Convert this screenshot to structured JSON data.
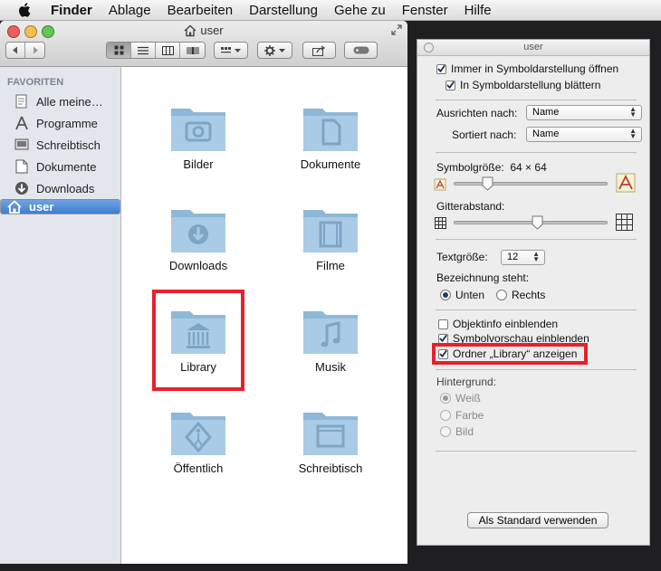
{
  "menubar": {
    "app_name": "Finder",
    "items": [
      "Ablage",
      "Bearbeiten",
      "Darstellung",
      "Gehe zu",
      "Fenster",
      "Hilfe"
    ]
  },
  "window": {
    "title": "user",
    "traffic_colors": [
      "#ed5f58",
      "#f5be4f",
      "#62c655"
    ]
  },
  "sidebar": {
    "header": "FAVORITEN",
    "items": [
      {
        "label": "Alle meine…",
        "icon": "all-files-icon"
      },
      {
        "label": "Programme",
        "icon": "applications-icon"
      },
      {
        "label": "Schreibtisch",
        "icon": "desktop-icon"
      },
      {
        "label": "Dokumente",
        "icon": "documents-icon"
      },
      {
        "label": "Downloads",
        "icon": "downloads-icon"
      },
      {
        "label": "user",
        "icon": "home-icon",
        "selected": true
      }
    ]
  },
  "folders": [
    {
      "label": "Bilder",
      "glyph": "camera"
    },
    {
      "label": "Dokumente",
      "glyph": "document"
    },
    {
      "label": "Downloads",
      "glyph": "download"
    },
    {
      "label": "Filme",
      "glyph": "film"
    },
    {
      "label": "Library",
      "glyph": "library",
      "highlighted": true
    },
    {
      "label": "Musik",
      "glyph": "music"
    },
    {
      "label": "Öffentlich",
      "glyph": "public"
    },
    {
      "label": "Schreibtisch",
      "glyph": "desktop"
    }
  ],
  "panel": {
    "title": "user",
    "always_icon_view": "Immer in Symboldarstellung öffnen",
    "browse_icon_view": "In Symboldarstellung blättern",
    "arrange_label": "Ausrichten nach:",
    "arrange_value": "Name",
    "sort_label": "Sortiert nach:",
    "sort_value": "Name",
    "icon_size_label": "Symbolgröße:",
    "icon_size_value": "64 × 64",
    "icon_size_level": 0.2,
    "grid_label": "Gitterabstand:",
    "grid_level": 0.55,
    "text_size_label": "Textgröße:",
    "text_size_value": "12",
    "label_position_label": "Bezeichnung steht:",
    "label_bottom": "Unten",
    "label_right": "Rechts",
    "show_item_info": "Objektinfo einblenden",
    "show_icon_preview": "Symbolvorschau einblenden",
    "show_library": "Ordner „Library“ anzeigen",
    "background_label": "Hintergrund:",
    "bg_white": "Weiß",
    "bg_color": "Farbe",
    "bg_picture": "Bild",
    "use_default_button": "Als Standard verwenden"
  },
  "colors": {
    "highlight": "#e8202a",
    "folder": "#9ec3df",
    "sidebar_selected": "#3d7fcf"
  }
}
